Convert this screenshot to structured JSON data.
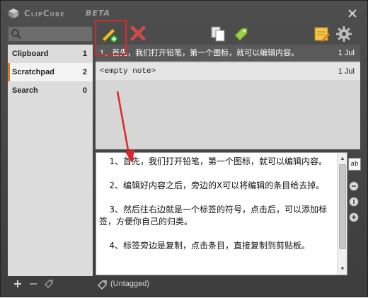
{
  "window": {
    "title": "ClipCube",
    "badge": "BETA"
  },
  "sidebar": {
    "items": [
      {
        "label": "Clipboard",
        "count": "1"
      },
      {
        "label": "Scratchpad",
        "count": "2"
      },
      {
        "label": "Search",
        "count": "0"
      }
    ]
  },
  "notes": [
    {
      "title": "1、首先，我们打开铅笔，第一个图标，就可以编辑内容。",
      "date": "1 Jul"
    },
    {
      "title": "<empty note>",
      "date": "1 Jul"
    }
  ],
  "editor": {
    "paragraphs": [
      "1、首先，我们打开铅笔，第一个图标，就可以编辑内容。",
      "2、编辑好内容之后，旁边的X可以将编辑的条目给去掉。",
      "3、然后往右边就是一个标签的符号，点击后，可以添加标签，方便你自己的归类。",
      "4、标签旁边是复制，点击条目，直接复制到剪贴板。"
    ]
  },
  "status": {
    "tag": "(Untagged)"
  },
  "right_tools": {
    "text_label": "ab"
  },
  "colors": {
    "active_accent": "#e07b1f",
    "highlight": "#e0262a"
  }
}
